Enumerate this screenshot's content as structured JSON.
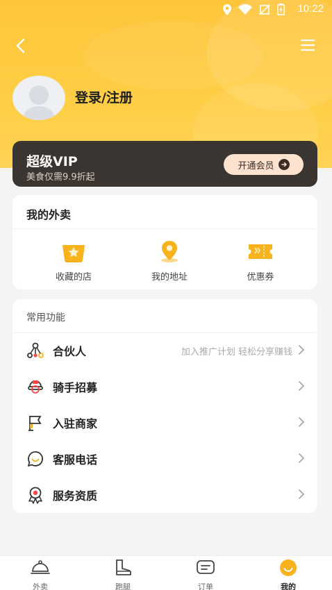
{
  "status_bar": {
    "time": "10:22"
  },
  "profile": {
    "login_label": "登录/注册"
  },
  "vip": {
    "title": "超级VIP",
    "subtitle": "美食仅需9.9折起",
    "button_label": "开通会员"
  },
  "my_takeaway": {
    "title": "我的外卖",
    "items": [
      {
        "label": "收藏的店",
        "icon": "star-shop-icon"
      },
      {
        "label": "我的地址",
        "icon": "location-pin-icon"
      },
      {
        "label": "优惠券",
        "icon": "coupon-icon"
      }
    ]
  },
  "common_functions": {
    "title": "常用功能",
    "items": [
      {
        "label": "合伙人",
        "hint": "加入推广计划 轻松分享赚钱",
        "icon": "partner-network-icon"
      },
      {
        "label": "骑手招募",
        "hint": "",
        "icon": "rider-icon"
      },
      {
        "label": "入驻商家",
        "hint": "",
        "icon": "flag-icon"
      },
      {
        "label": "客服电话",
        "hint": "",
        "icon": "chat-bubble-icon"
      },
      {
        "label": "服务资质",
        "hint": "",
        "icon": "award-badge-icon"
      }
    ]
  },
  "tab_bar": {
    "active": "我的",
    "tabs": [
      {
        "label": "外卖",
        "icon": "cloche-icon"
      },
      {
        "label": "跑腿",
        "icon": "boot-icon"
      },
      {
        "label": "订单",
        "icon": "order-list-icon"
      },
      {
        "label": "我的",
        "icon": "smiley-profile-icon"
      }
    ]
  },
  "colors": {
    "brand_yellow": "#ffc53a",
    "vip_dark": "#3b3531",
    "vip_button": "#fde2cf",
    "icon_accent": "#f7b21c"
  }
}
